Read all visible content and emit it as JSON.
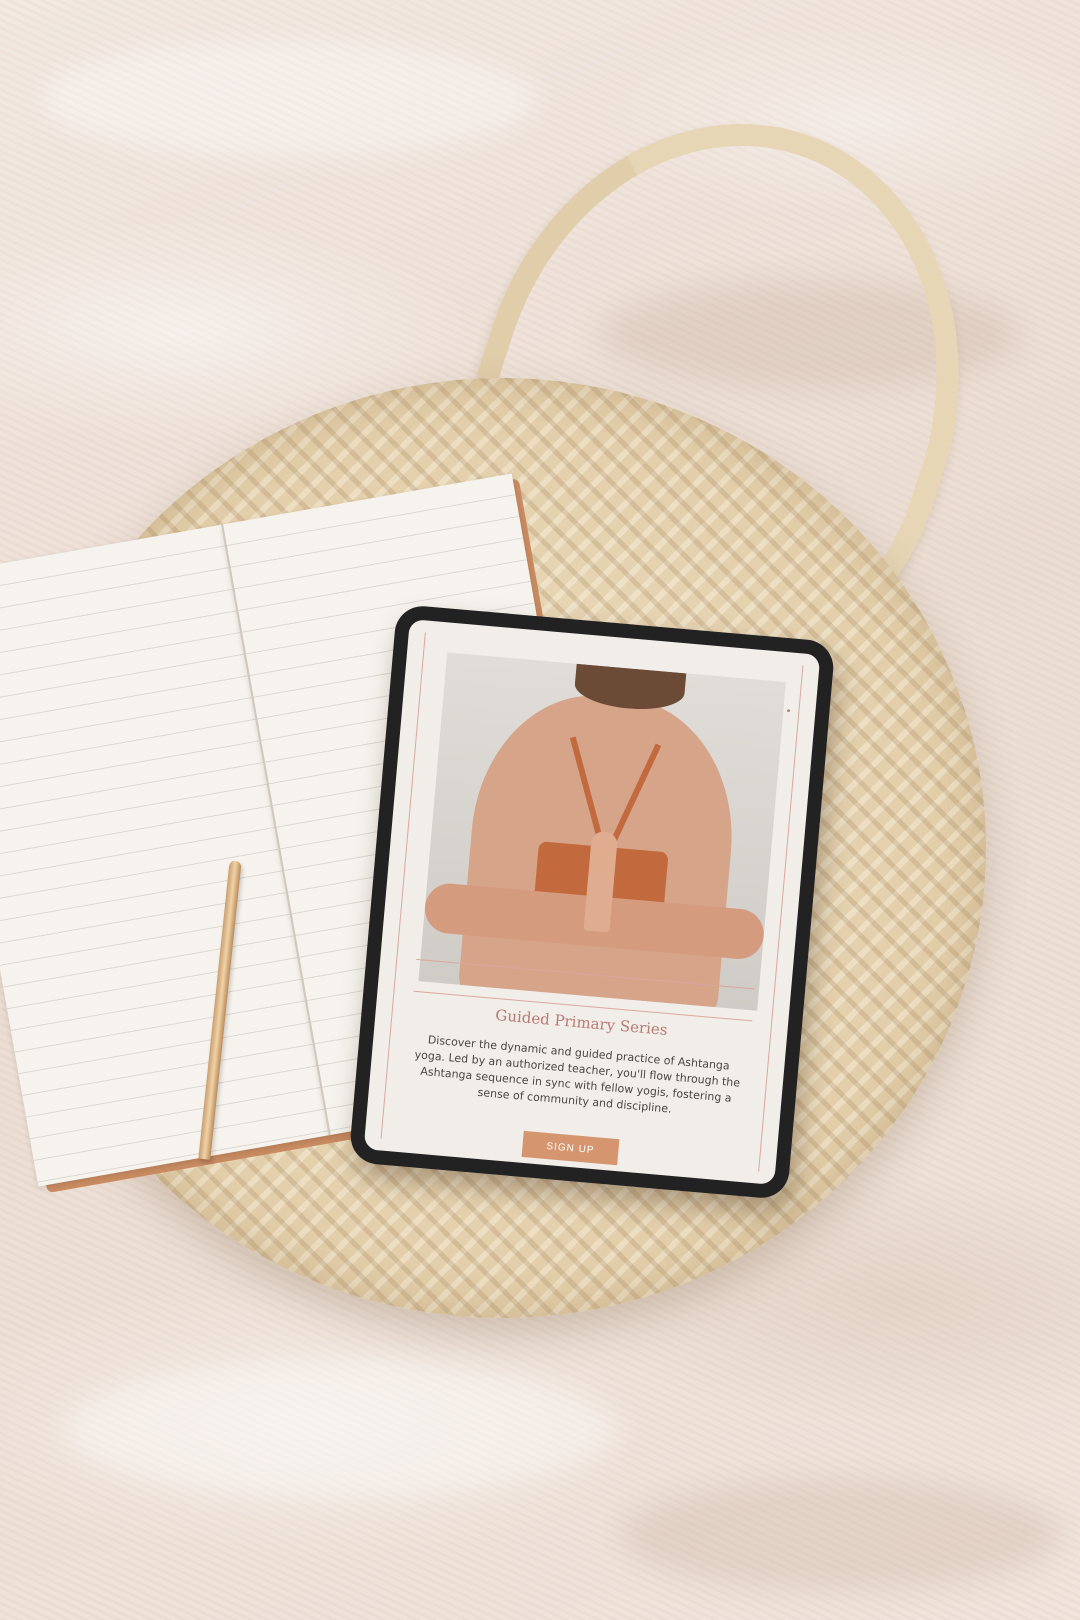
{
  "scene": {
    "description_colors": {
      "blanket": "#efe4dc",
      "bag": "#e3cfab",
      "notebook_cover": "#c98b61",
      "accent_title": "#b87a74",
      "button": "#d5956f"
    }
  },
  "tablet_screen": {
    "title": "Guided Primary Series",
    "body": "Discover the dynamic and guided practice of Ashtanga yoga. Led by an authorized teacher, you'll flow through the Ashtanga sequence in sync with fellow yogis, fostering a sense of community and discipline.",
    "button_label": "SIGN UP"
  }
}
